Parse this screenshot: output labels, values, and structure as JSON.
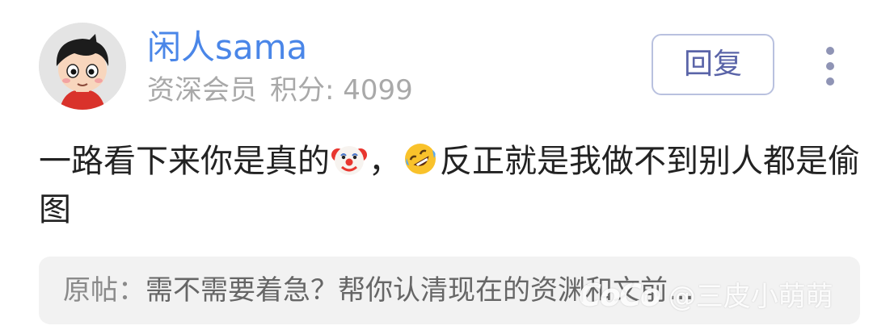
{
  "comment": {
    "author": {
      "name": "闲人sama",
      "level": "资深会员",
      "points_label": "积分:",
      "points_value": "4099",
      "avatar_icon": "cartoon-avatar"
    },
    "reply_label": "回复",
    "more_icon": "more-vertical-icon",
    "body": {
      "part1": "一路看下来你是真的",
      "emoji1": "clown-face-emoji",
      "part2": "，",
      "emoji2": "rolling-on-floor-laughing-emoji",
      "part3": "反正就是我做不到别人都是偷图"
    },
    "quote": {
      "label": "原帖：",
      "text": "需不需要着急？帮你认清现在的资渊和文前..."
    }
  },
  "watermark": {
    "logo": "CoCo",
    "handle": "@三皮小萌萌"
  },
  "colors": {
    "username": "#4a86e8",
    "meta": "#a9a9a9",
    "reply_border": "#b9c1df",
    "reply_text": "#5a64a8",
    "quote_bg": "#f2f2f2"
  }
}
